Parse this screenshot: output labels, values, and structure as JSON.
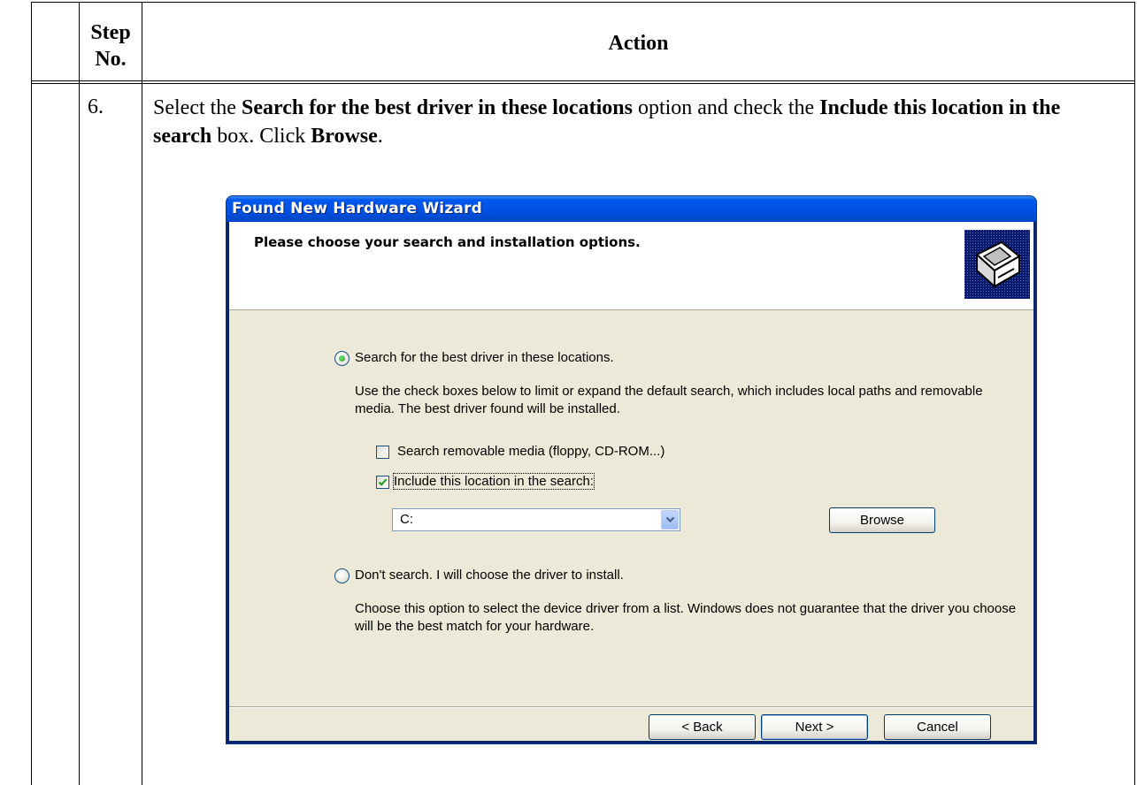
{
  "table": {
    "header_step": "Step No.",
    "header_action": "Action",
    "step_number": "6.",
    "instruction": {
      "t1": "Select the ",
      "b1": "Search for the best driver in these locations",
      "t2": " option and check the ",
      "b2": "Include this location in the search",
      "t3": " box.  Click ",
      "b3": "Browse",
      "t4": "."
    }
  },
  "dialog": {
    "title": "Found New Hardware Wizard",
    "header_title": "Please choose your search and installation options.",
    "icon": "hardware-wizard-icon",
    "option_search": {
      "label": "Search for the best driver in these locations.",
      "selected": true,
      "description": "Use the check boxes below to limit or expand the default search, which includes local paths and removable media. The best driver found will be installed."
    },
    "check_removable": {
      "label": "Search removable media (floppy, CD-ROM...)",
      "checked": false
    },
    "check_include": {
      "label": "Include this location in the search:",
      "checked": true
    },
    "location_value": "C:",
    "browse_label": "Browse",
    "option_dont_search": {
      "label": "Don't search. I will choose the driver to install.",
      "selected": false,
      "description": "Choose this option to select the device driver from a list.  Windows does not guarantee that the driver you choose will be the best match for your hardware."
    },
    "buttons": {
      "back": "< Back",
      "next": "Next >",
      "cancel": "Cancel"
    }
  },
  "colors": {
    "titlebar": "#0058ee",
    "dialog_face": "#ece9d8",
    "header_bg": "#ffffff",
    "radio_dot": "#21a121",
    "check_mark": "#21a121"
  }
}
